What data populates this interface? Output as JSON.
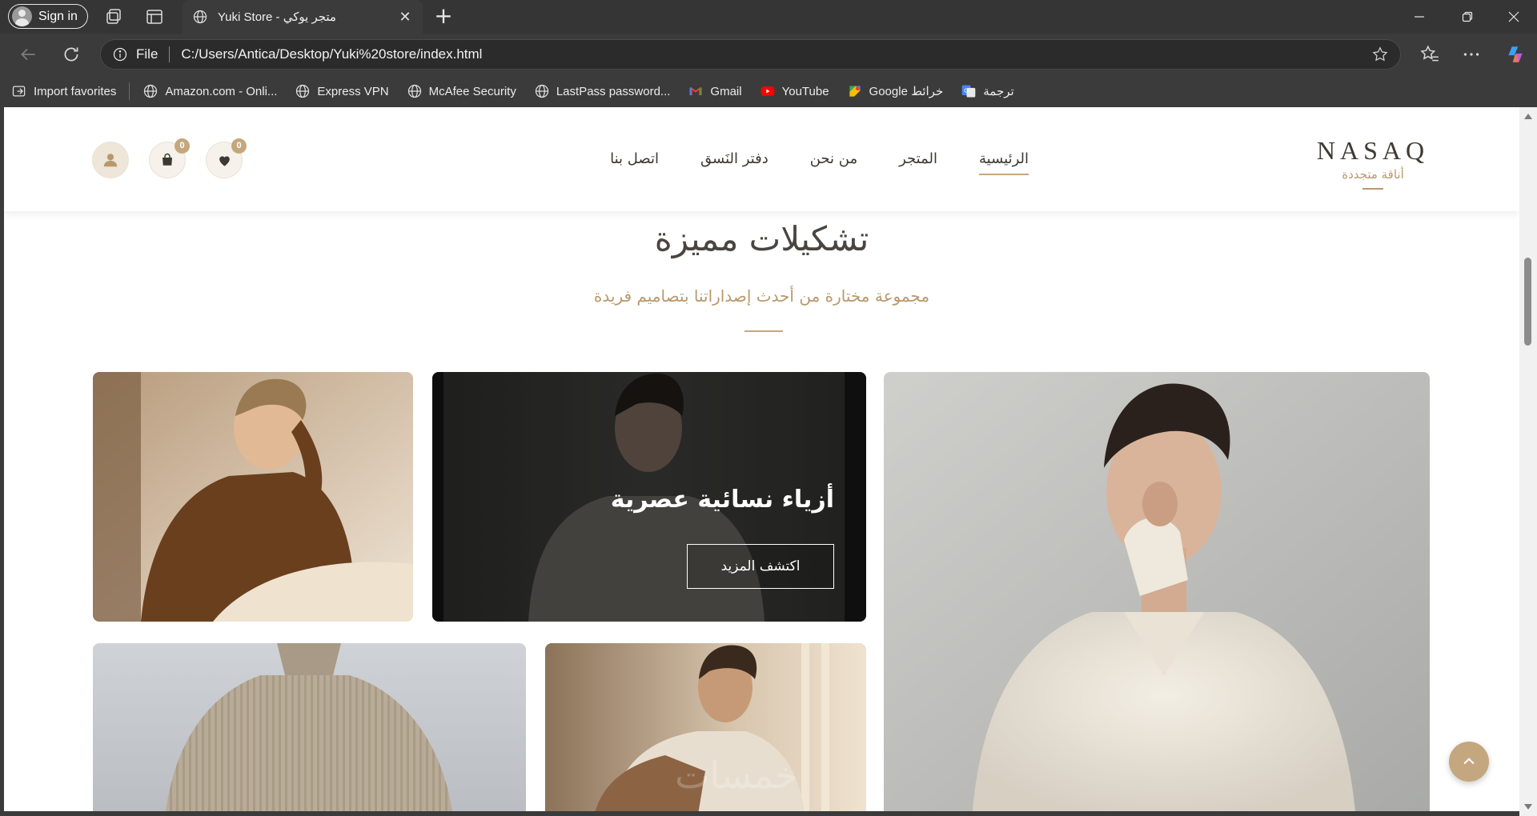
{
  "browser": {
    "signin_label": "Sign in",
    "tab_title": "Yuki Store - متجر يوكي",
    "tab_close": "✕",
    "newtab": "+",
    "address_scheme": "File",
    "address_url": "C:/Users/Antica/Desktop/Yuki%20store/index.html",
    "bookmarks": [
      {
        "label": "Import favorites",
        "icon": "import-icon"
      },
      {
        "label": "Amazon.com - Onli...",
        "icon": "globe-icon"
      },
      {
        "label": "Express VPN",
        "icon": "globe-icon"
      },
      {
        "label": "McAfee Security",
        "icon": "globe-icon"
      },
      {
        "label": "LastPass password...",
        "icon": "globe-icon"
      },
      {
        "label": "Gmail",
        "icon": "gmail-icon"
      },
      {
        "label": "YouTube",
        "icon": "youtube-icon"
      },
      {
        "label": "Google خرائط",
        "icon": "maps-icon"
      },
      {
        "label": "ترجمة",
        "icon": "translate-icon"
      }
    ]
  },
  "site": {
    "brand_name": "NASAQ",
    "brand_tagline": "أناقة متجددة",
    "nav": [
      {
        "label": "الرئيسية",
        "active": true
      },
      {
        "label": "المتجر",
        "active": false
      },
      {
        "label": "من نحن",
        "active": false
      },
      {
        "label": "دفتر النَسق",
        "active": false
      },
      {
        "label": "اتصل بنا",
        "active": false
      }
    ],
    "wishlist_count": "0",
    "cart_count": "0",
    "accent_color": "#c4a77e"
  },
  "section": {
    "title": "تشكيلات مميزة",
    "subtitle": "مجموعة مختارة من أحدث إصداراتنا بتصاميم فريدة"
  },
  "featured_card": {
    "title": "أزياء نسائية عصرية",
    "button_label": "اكتشف المزيد"
  },
  "watermark": "خمسات"
}
